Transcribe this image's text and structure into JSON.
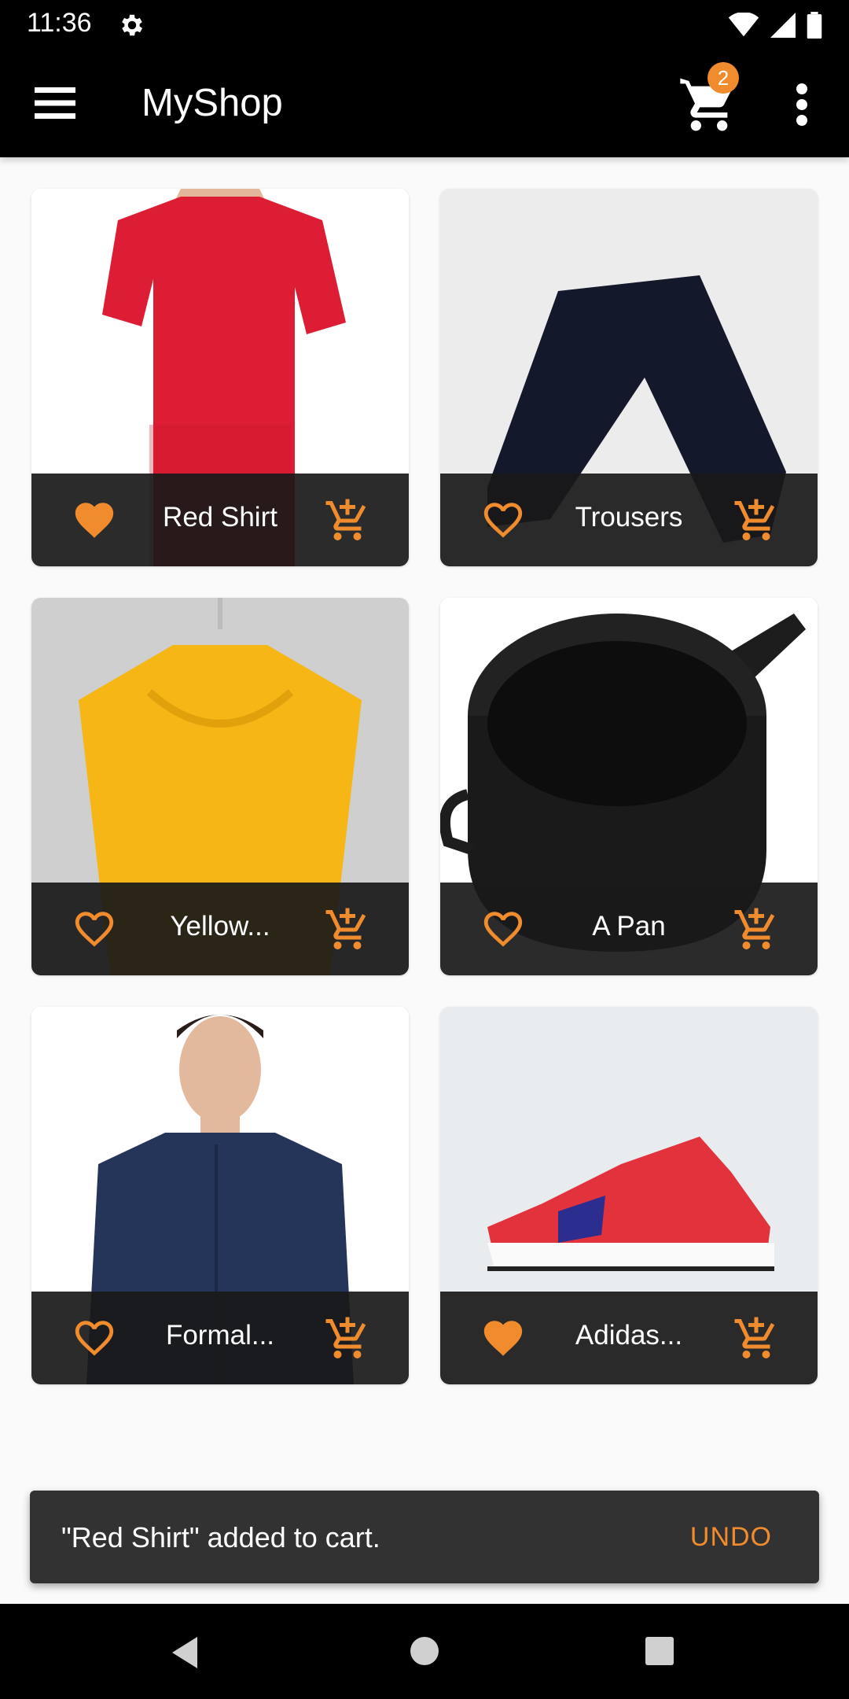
{
  "status_bar": {
    "time": "11:36",
    "icons": [
      "gear-icon",
      "wifi-icon",
      "signal-icon",
      "battery-icon"
    ]
  },
  "app_bar": {
    "title": "MyShop",
    "cart_count": "2",
    "icons": [
      "menu-icon",
      "cart-icon",
      "more-vert-icon"
    ]
  },
  "products": [
    {
      "name": "Red Shirt",
      "favorited": true
    },
    {
      "name": "Trousers",
      "favorited": false
    },
    {
      "name": "Yellow...",
      "favorited": false
    },
    {
      "name": "A Pan",
      "favorited": false
    },
    {
      "name": "Formal...",
      "favorited": false
    },
    {
      "name": "Adidas...",
      "favorited": true
    }
  ],
  "snackbar": {
    "message": "\"Red Shirt\" added to cart.",
    "action": "UNDO"
  },
  "colors": {
    "accent": "#f08c2d",
    "app_bar": "#000000",
    "background": "#fafafa",
    "snackbar": "#323232"
  }
}
